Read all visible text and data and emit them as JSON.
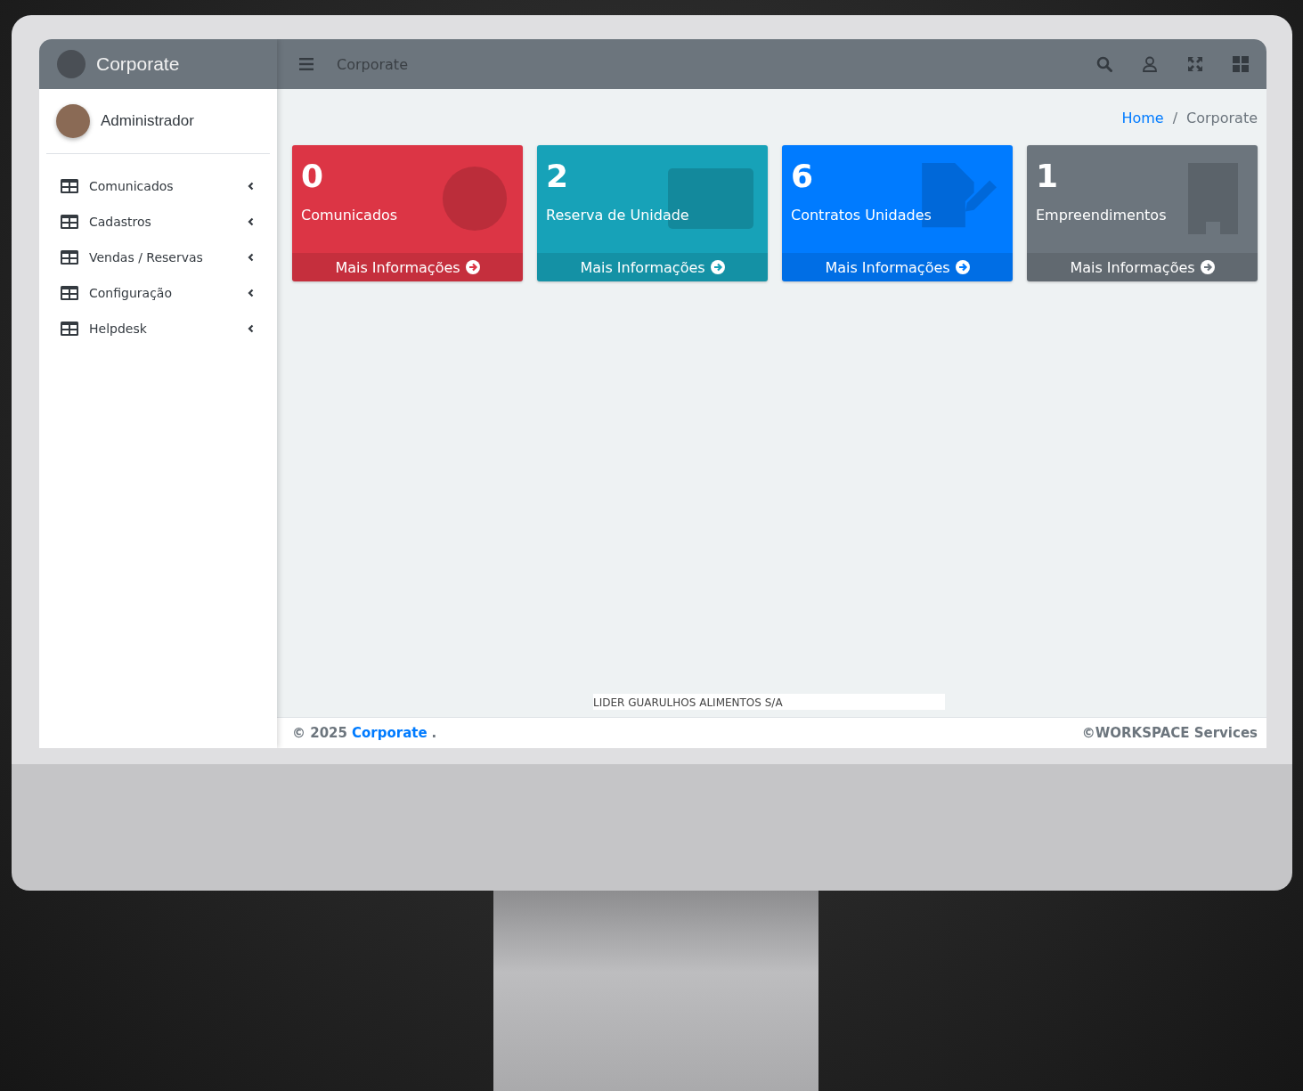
{
  "sidebar": {
    "brand": "Corporate",
    "user": "Administrador",
    "items": [
      {
        "label": "Comunicados",
        "expanded": false
      },
      {
        "label": "Cadastros",
        "expanded": false
      },
      {
        "label": "Vendas / Reservas",
        "expanded": false
      },
      {
        "label": "Configuração",
        "expanded": false
      },
      {
        "label": "Helpdesk",
        "expanded": false
      }
    ]
  },
  "header": {
    "title": "Corporate"
  },
  "breadcrumb": {
    "separator": "/",
    "items": [
      {
        "label": "Home",
        "current": false
      },
      {
        "label": "Corporate",
        "current": true
      }
    ]
  },
  "cards": [
    {
      "kind": "alert",
      "value": "0",
      "label": "Comunicados",
      "link": "Mais Informações",
      "color": "#dc3545"
    },
    {
      "kind": "money",
      "value": "2",
      "label": "Reserva de Unidade",
      "link": "Mais Informações",
      "color": "#17a2b8"
    },
    {
      "kind": "contract",
      "value": "6",
      "label": "Contratos Unidades",
      "link": "Mais Informações",
      "color": "#007bff"
    },
    {
      "kind": "building",
      "value": "1",
      "label": "Empreendimentos",
      "link": "Mais Informações",
      "color": "#6c757d"
    }
  ],
  "company": "LIDER GUARULHOS ALIMENTOS S/A",
  "footer": {
    "copyright": "© 2025",
    "link": "Corporate",
    "end": ".",
    "right": "©WORKSPACE Services"
  }
}
